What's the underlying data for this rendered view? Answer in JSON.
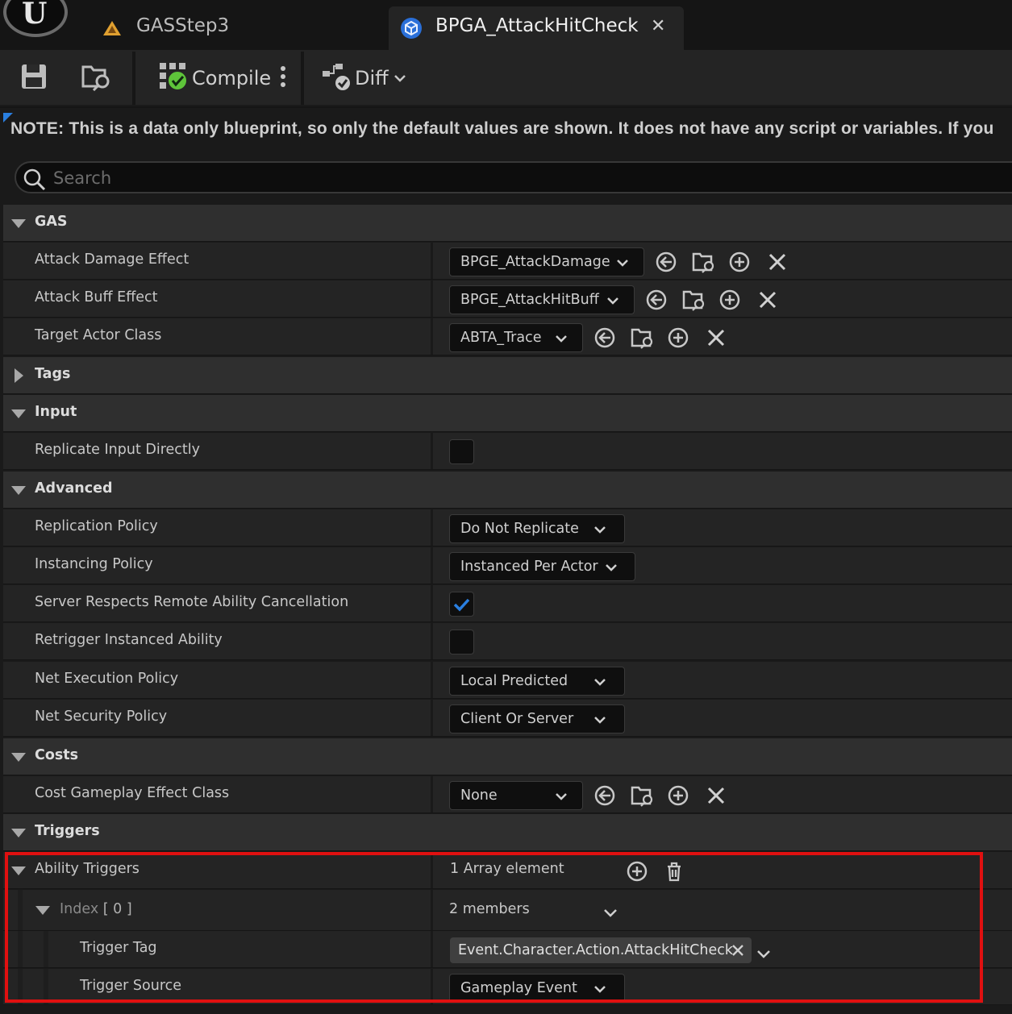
{
  "tabs": [
    {
      "label": "GASStep3",
      "icon": "warning-triangle-icon"
    },
    {
      "label": "BPGA_AttackHitCheck",
      "icon": "blueprint-class-icon",
      "active": true
    }
  ],
  "toolbar": {
    "compile_label": "Compile",
    "diff_label": "Diff"
  },
  "notice": "NOTE: This is a data only blueprint, so only the default values are shown.  It does not have any script or variables.  If you",
  "search": {
    "placeholder": "Search",
    "value": ""
  },
  "sections": {
    "gas": {
      "label": "GAS",
      "attack_damage_effect": {
        "label": "Attack Damage Effect",
        "value": "BPGE_AttackDamage"
      },
      "attack_buff_effect": {
        "label": "Attack Buff Effect",
        "value": "BPGE_AttackHitBuff"
      },
      "target_actor_class": {
        "label": "Target Actor Class",
        "value": "ABTA_Trace"
      }
    },
    "tags": {
      "label": "Tags"
    },
    "input": {
      "label": "Input",
      "replicate_input_directly": {
        "label": "Replicate Input Directly",
        "checked": false
      }
    },
    "advanced": {
      "label": "Advanced",
      "replication_policy": {
        "label": "Replication Policy",
        "value": "Do Not Replicate"
      },
      "instancing_policy": {
        "label": "Instancing Policy",
        "value": "Instanced Per Actor"
      },
      "server_respects_remote_cancel": {
        "label": "Server Respects Remote Ability Cancellation",
        "checked": true
      },
      "retrigger_instanced_ability": {
        "label": "Retrigger Instanced Ability",
        "checked": false
      },
      "net_execution_policy": {
        "label": "Net Execution Policy",
        "value": "Local Predicted"
      },
      "net_security_policy": {
        "label": "Net Security Policy",
        "value": "Client Or Server"
      }
    },
    "costs": {
      "label": "Costs",
      "cost_gameplay_effect_class": {
        "label": "Cost Gameplay Effect Class",
        "value": "None"
      }
    },
    "triggers": {
      "label": "Triggers",
      "ability_triggers": {
        "label": "Ability Triggers",
        "summary": "1 Array element"
      },
      "index0": {
        "label": "Index",
        "index_text": "[ 0 ]",
        "summary": "2 members"
      },
      "trigger_tag": {
        "label": "Trigger Tag",
        "value": "Event.Character.Action.AttackHitCheck"
      },
      "trigger_source": {
        "label": "Trigger Source",
        "value": "Gameplay Event"
      }
    }
  },
  "colors": {
    "accent_blue": "#2a7fe0",
    "highlight_red": "#e01010",
    "compile_ok_green": "#5ec43a"
  }
}
